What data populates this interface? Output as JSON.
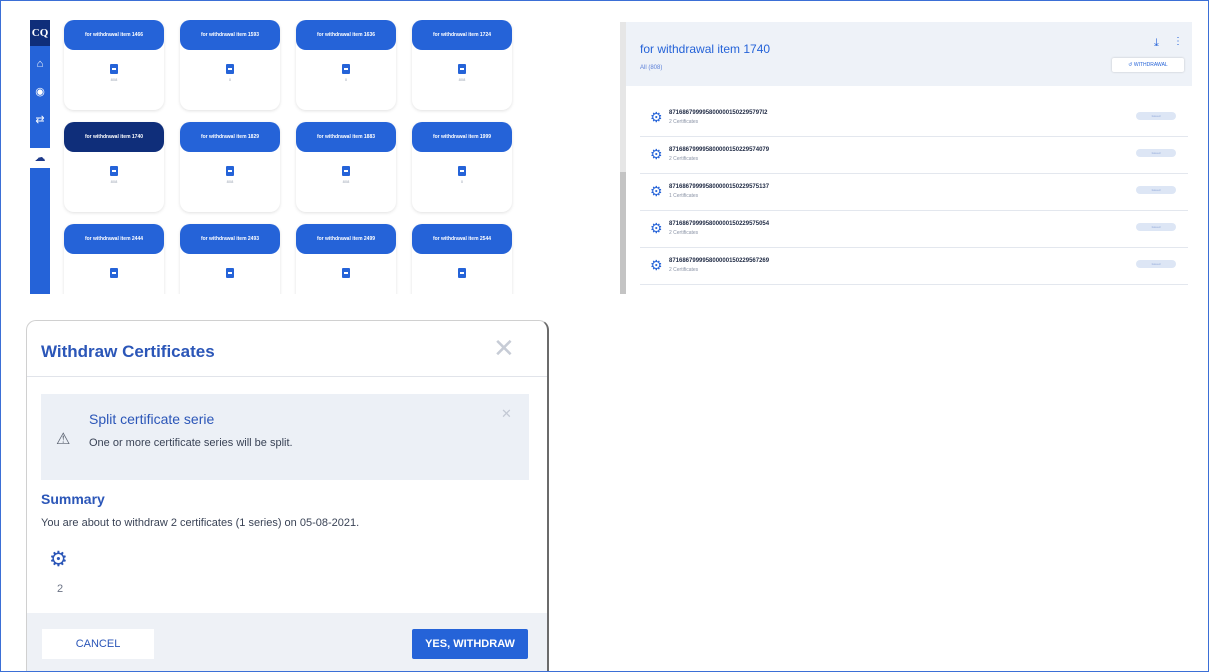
{
  "grid_panel": {
    "logo": "CQ",
    "nav_icons": [
      "home-icon",
      "certificate-icon",
      "transfer-icon",
      "cloud-icon"
    ],
    "cards": [
      {
        "title": "for withdrawal item 1466",
        "count": "808",
        "selected": false
      },
      {
        "title": "for withdrawal item 1593",
        "count": "0",
        "selected": false
      },
      {
        "title": "for withdrawal item 1636",
        "count": "0",
        "selected": false
      },
      {
        "title": "for withdrawal item 1724",
        "count": "808",
        "selected": false
      },
      {
        "title": "for withdrawal item 1740",
        "count": "808",
        "selected": true
      },
      {
        "title": "for withdrawal item 1829",
        "count": "808",
        "selected": false
      },
      {
        "title": "for withdrawal item 1883",
        "count": "808",
        "selected": false
      },
      {
        "title": "for withdrawal item 1999",
        "count": "0",
        "selected": false
      },
      {
        "title": "for withdrawal item 2444",
        "count": "",
        "selected": false
      },
      {
        "title": "for withdrawal item 2493",
        "count": "",
        "selected": false
      },
      {
        "title": "for withdrawal item 2499",
        "count": "",
        "selected": false
      },
      {
        "title": "for withdrawal item 2544",
        "count": "",
        "selected": false
      }
    ]
  },
  "list_panel": {
    "title": "for withdrawal item 1740",
    "filter": "All (808)",
    "withdrawal_button": "WITHDRAWAL",
    "rows": [
      {
        "id": "8716867999958000001502295797I2",
        "certificates": "2 Certificates",
        "status": "Issued"
      },
      {
        "id": "871686799995800000150229574079",
        "certificates": "2 Certificates",
        "status": "Issued"
      },
      {
        "id": "871686799995800000150229575137",
        "certificates": "1 Certificates",
        "status": "Issued"
      },
      {
        "id": "871686799995800000150229575054",
        "certificates": "2 Certificates",
        "status": "Issued"
      },
      {
        "id": "871686799995800000150229567269",
        "certificates": "2 Certificates",
        "status": "Issued"
      }
    ]
  },
  "dialog": {
    "title": "Withdraw Certificates",
    "alert": {
      "title": "Split certificate serie",
      "message": "One or more certificate series will be split."
    },
    "summary_title": "Summary",
    "summary_text": "You are about to withdraw 2 certificates (1 series) on 05-08-2021.",
    "certificate_count": "2",
    "cancel_label": "CANCEL",
    "confirm_label": "YES, WITHDRAW"
  },
  "colors": {
    "primary": "#2563d8",
    "dark_primary": "#0f2e7a",
    "panel_bg": "#eef2f8"
  }
}
